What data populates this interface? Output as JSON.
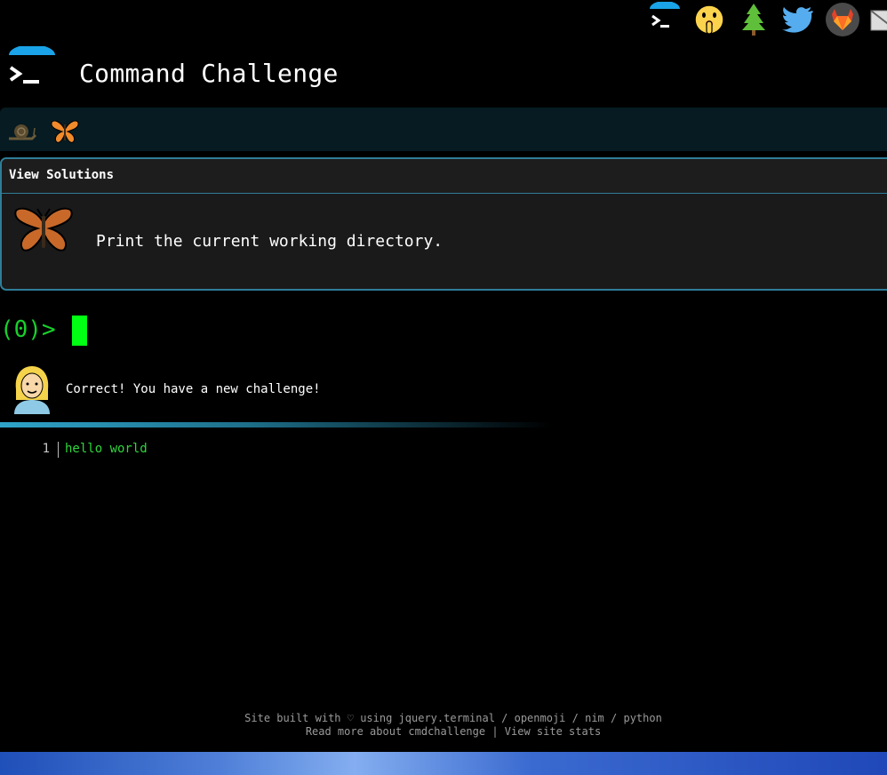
{
  "header": {
    "title": "Command Challenge"
  },
  "top_icons": [
    "terminal-icon",
    "shushing-face-icon",
    "tree-icon",
    "twitter-bird-icon",
    "gitlab-fox-icon",
    "mail-icon"
  ],
  "level_bar": {
    "icons": [
      "snail-icon",
      "butterfly-icon"
    ]
  },
  "card": {
    "view_solutions": "View Solutions",
    "challenge": "Print the current working directory."
  },
  "terminal": {
    "prompt": "(0)>",
    "message": "Correct! You have a new challenge!",
    "output": [
      {
        "num": "1",
        "text": "hello world"
      }
    ]
  },
  "footer": {
    "line1_prefix": "Site built with ♡ using ",
    "links1": [
      "jquery.terminal",
      "openmoji",
      "nim",
      "python"
    ],
    "sep": " / ",
    "link_readmore": "Read more about cmdchallenge",
    "pipe": " | ",
    "link_stats": "View site stats"
  },
  "colors": {
    "accent": "#2f7d98",
    "prompt_green": "#17d12b",
    "cursor_green": "#00ff12",
    "output_green": "#2ed63c",
    "level_bar_bg": "#061b22"
  }
}
